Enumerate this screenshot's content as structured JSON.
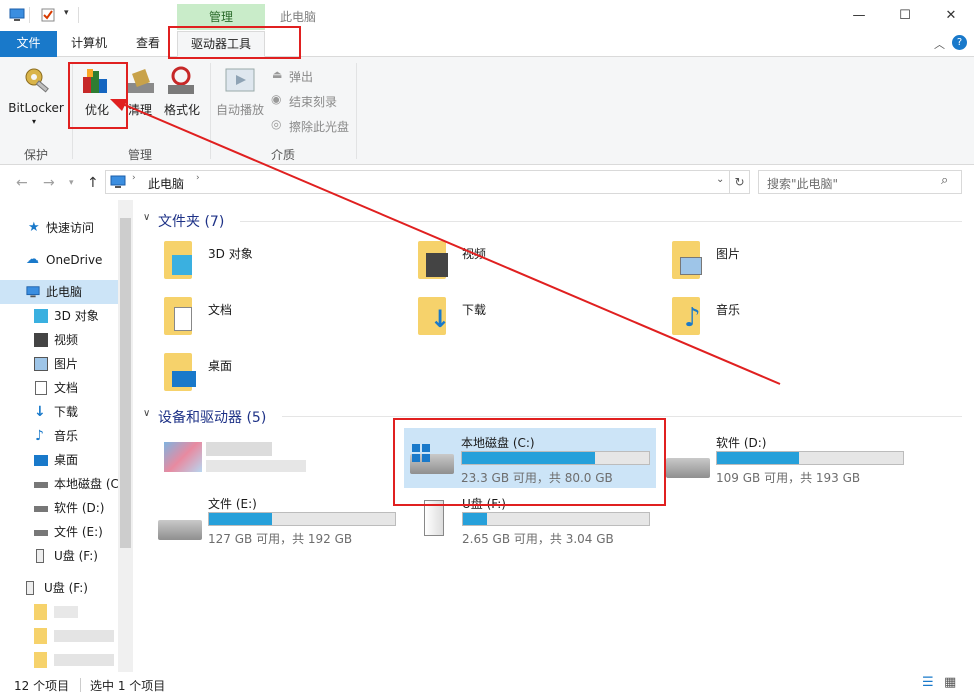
{
  "window": {
    "title": "此电脑",
    "context_tab_label": "管理",
    "minimize_glyph": "—",
    "maximize_glyph": "☐",
    "close_glyph": "✕"
  },
  "ribbon_tabs": {
    "file": "文件",
    "computer": "计算机",
    "view": "查看",
    "drive_tools": "驱动器工具"
  },
  "ribbon": {
    "bitlocker": "BitLocker",
    "optimize": "优化",
    "cleanup": "清理",
    "format": "格式化",
    "autoplay": "自动播放",
    "eject": "弹出",
    "finish_burning": "结束刻录",
    "erase_disc": "擦除此光盘",
    "group_protect": "保护",
    "group_manage": "管理",
    "group_media": "介质"
  },
  "address": {
    "path": "此电脑",
    "search_placeholder": "搜索\"此电脑\""
  },
  "nav": {
    "quick_access": "快速访问",
    "onedrive": "OneDrive",
    "this_pc": "此电脑",
    "objects3d": "3D 对象",
    "videos": "视频",
    "pictures": "图片",
    "documents": "文档",
    "downloads": "下载",
    "music": "音乐",
    "desktop": "桌面",
    "local_c": "本地磁盘 (C",
    "soft_d": "软件 (D:)",
    "file_e": "文件 (E:)",
    "udisk_f": "U盘 (F:)",
    "udisk_f_root": "U盘 (F:)"
  },
  "folders_section": {
    "title": "文件夹 (7)",
    "items": [
      "3D 对象",
      "视频",
      "图片",
      "文档",
      "下载",
      "音乐",
      "桌面"
    ]
  },
  "drives_section": {
    "title": "设备和驱动器 (5)",
    "drives": [
      {
        "name": "本地磁盘 (C:)",
        "info": "23.3 GB 可用，共 80.0 GB",
        "used_fraction": 0.71
      },
      {
        "name": "软件 (D:)",
        "info": "109 GB 可用，共 193 GB",
        "used_fraction": 0.44
      },
      {
        "name": "文件 (E:)",
        "info": "127 GB 可用，共 192 GB",
        "used_fraction": 0.34
      },
      {
        "name": "U盘 (F:)",
        "info": "2.65 GB 可用，共 3.04 GB",
        "used_fraction": 0.13
      }
    ]
  },
  "status": {
    "item_count": "12 个项目",
    "selected": "选中 1 个项目"
  },
  "colors": {
    "accent": "#1979ca",
    "drive_fill": "#26a0da",
    "annotation": "#e02020",
    "context_tab": "#c9ecc9"
  }
}
